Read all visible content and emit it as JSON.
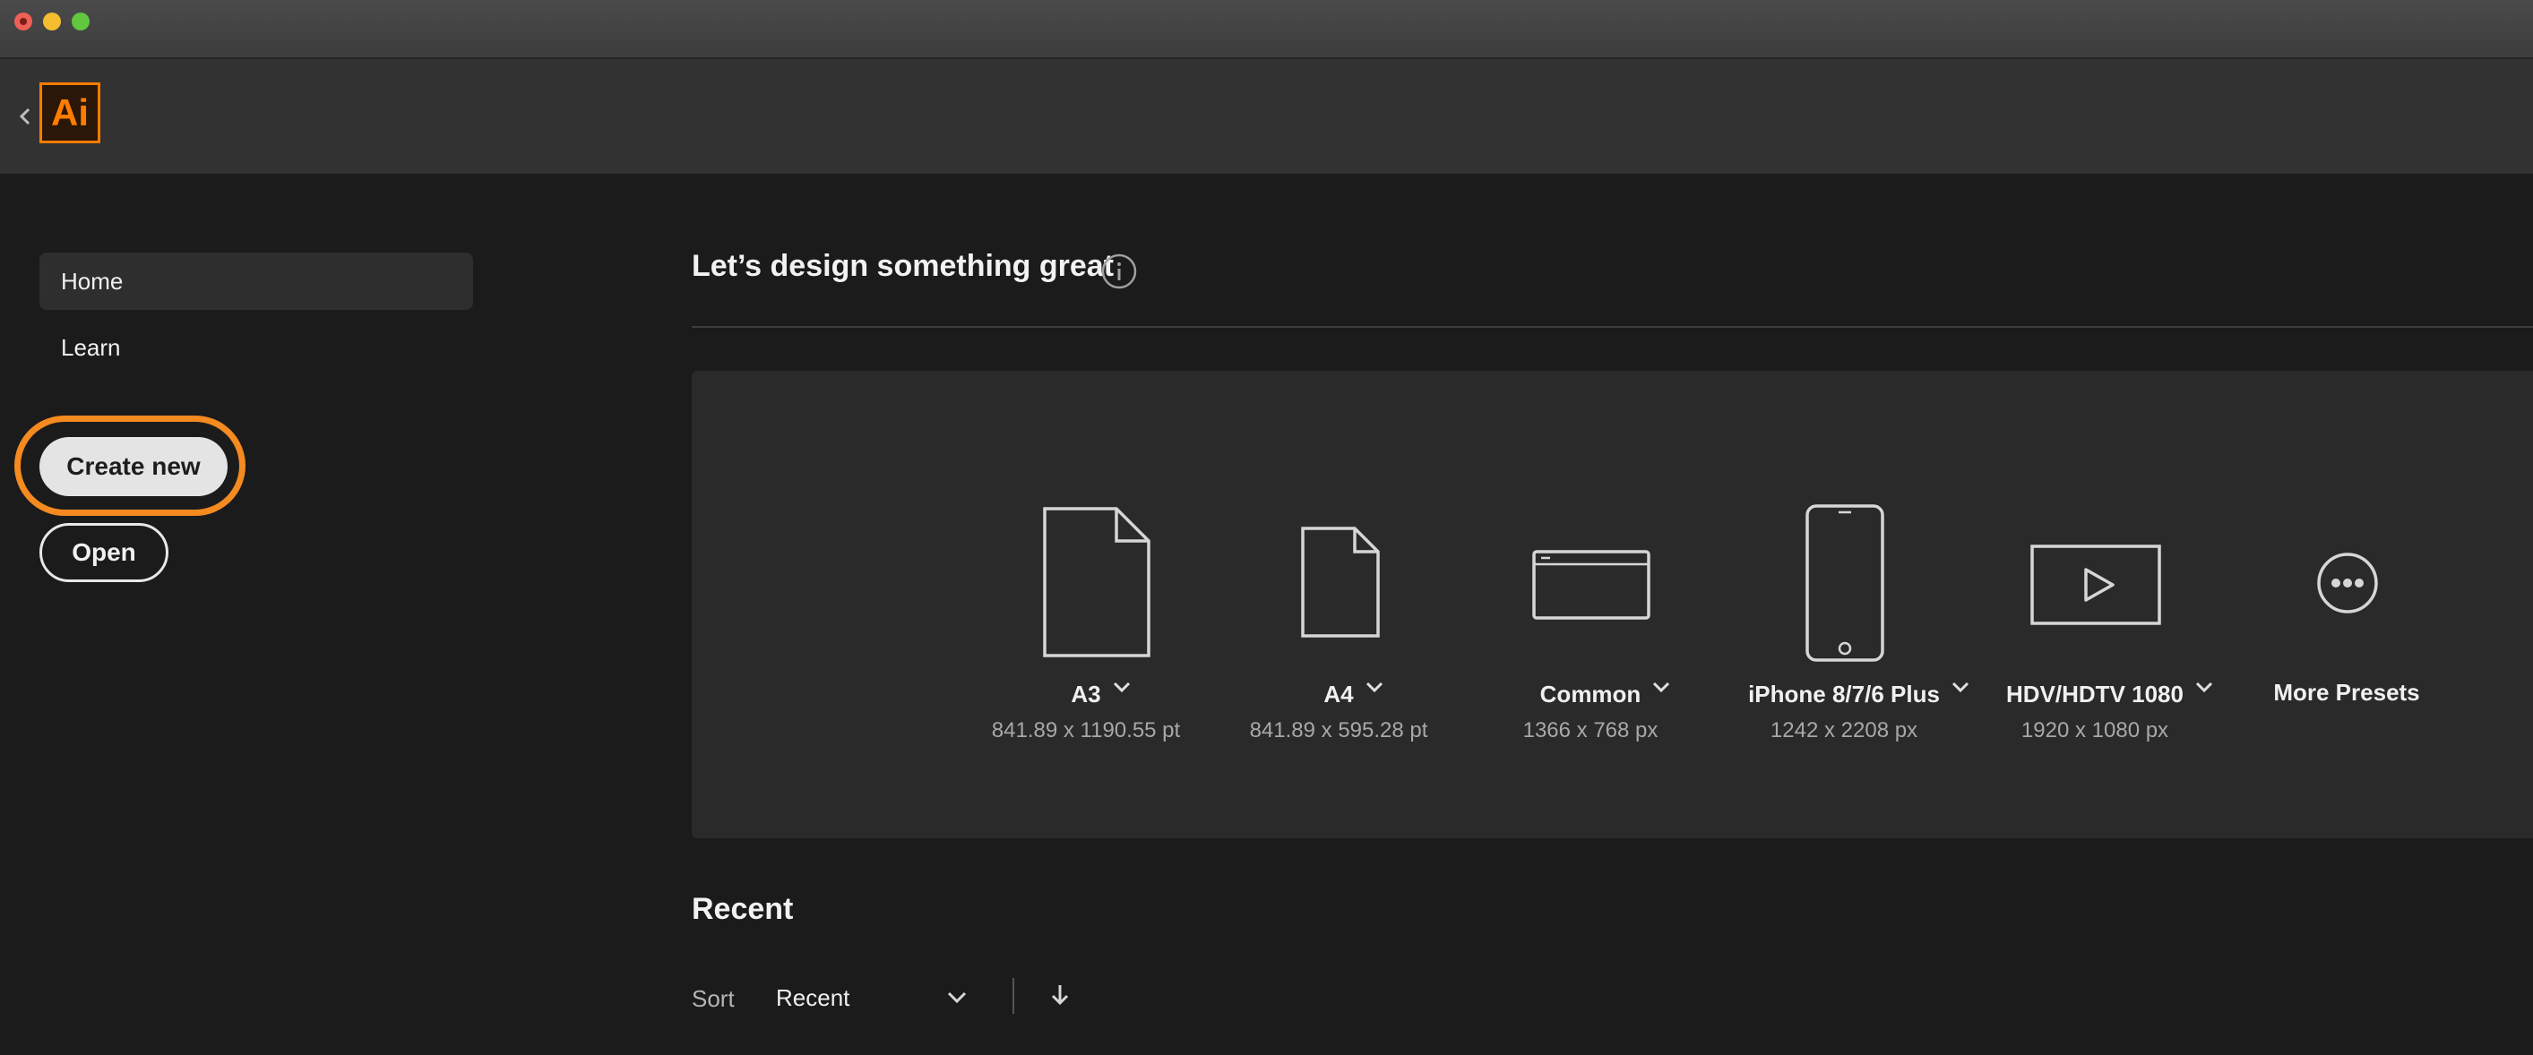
{
  "app": {
    "logo_text": "Ai",
    "accent_color": "#ff7c00"
  },
  "sidebar": {
    "items": [
      {
        "label": "Home",
        "selected": true
      },
      {
        "label": "Learn",
        "selected": false
      }
    ],
    "create_new_label": "Create new",
    "open_label": "Open"
  },
  "main": {
    "headline": "Let’s design something great",
    "presets": [
      {
        "name": "A3",
        "size": "841.89 x 1190.55 pt",
        "icon": "document-large-icon",
        "has_dropdown": true
      },
      {
        "name": "A4",
        "size": "841.89 x 595.28 pt",
        "icon": "document-icon",
        "has_dropdown": true
      },
      {
        "name": "Common",
        "size": "1366 x 768 px",
        "icon": "browser-window-icon",
        "has_dropdown": true
      },
      {
        "name": "iPhone 8/7/6 Plus",
        "size": "1242 x 2208 px",
        "icon": "phone-icon",
        "has_dropdown": true
      },
      {
        "name": "HDV/HDTV 1080",
        "size": "1920 x 1080 px",
        "icon": "video-play-icon",
        "has_dropdown": true
      },
      {
        "name": "More Presets",
        "size": "",
        "icon": "more-dots-icon",
        "has_dropdown": false
      }
    ],
    "recent": {
      "title": "Recent",
      "sort_label": "Sort",
      "sort_value": "Recent"
    }
  }
}
